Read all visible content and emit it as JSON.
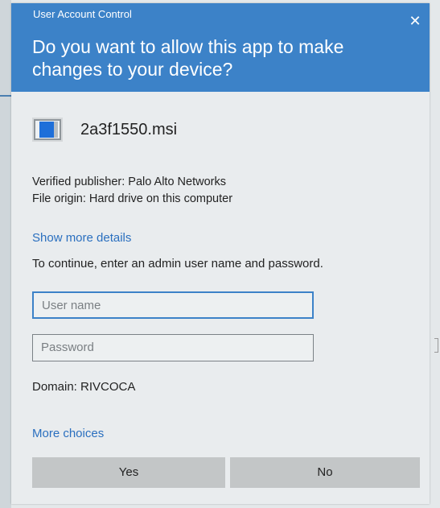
{
  "window": {
    "title": "User Account Control",
    "close_icon": "close-icon"
  },
  "prompt": {
    "question": "Do you want to allow this app to make changes to your device?"
  },
  "app": {
    "icon": "installer-icon",
    "name": "2a3f1550.msi"
  },
  "details": {
    "publisher": "Verified publisher: Palo Alto Networks",
    "origin": "File origin: Hard drive on this computer",
    "show_more_label": "Show more details"
  },
  "credentials": {
    "instruction": "To continue, enter an admin user name and password.",
    "username_placeholder": "User name",
    "password_placeholder": "Password",
    "domain": "Domain: RIVCOCA",
    "more_choices_label": "More choices"
  },
  "buttons": {
    "yes_label": "Yes",
    "no_label": "No"
  },
  "colors": {
    "header": "#3c82c8",
    "link": "#2a6fbf",
    "button": "#c3c6c7"
  }
}
